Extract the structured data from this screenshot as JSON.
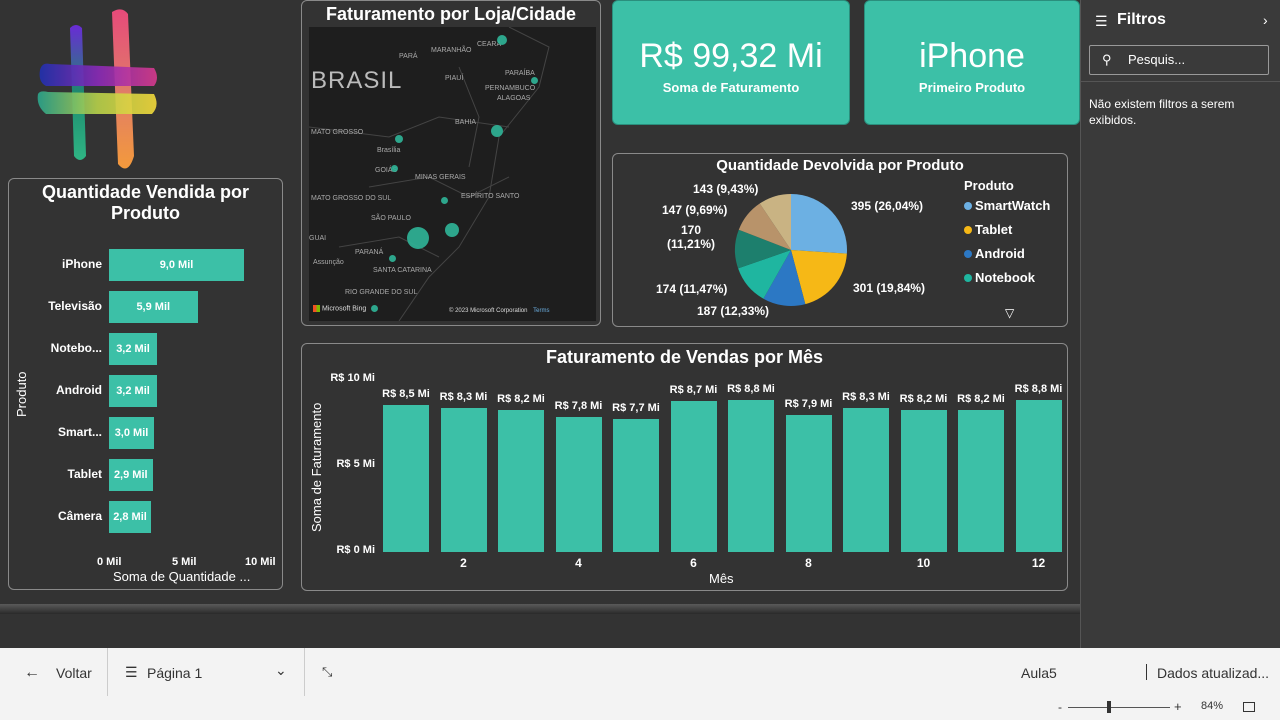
{
  "map": {
    "title": "Faturamento por Loja/Cidade",
    "labels": [
      "BRASIL",
      "PARÁ",
      "MARANHÃO",
      "CEARÁ",
      "PARAÍBA",
      "PIAUÍ",
      "PERNAMBUCO",
      "ALAGOAS",
      "BAHIA",
      "MATO GROSSO",
      "Brasília",
      "GOIÁS",
      "MINAS GERAIS",
      "ESPÍRITO SANTO",
      "MATO GROSSO DO SUL",
      "SÃO PAULO",
      "PARANÁ",
      "SANTA CATARINA",
      "RIO GRANDE DO SUL",
      "Assunção",
      "GUAI"
    ],
    "brand": "Microsoft Bing",
    "copyright": "© 2023 Microsoft Corporation",
    "terms": "Terms"
  },
  "kpi": {
    "total_value": "R$ 99,32 Mi",
    "total_label": "Soma de Faturamento",
    "top_value": "iPhone",
    "top_label": "Primeiro Produto"
  },
  "qty_chart": {
    "title": "Quantidade Vendida por Produto",
    "ylabel": "Produto",
    "xlabel": "Soma de Quantidade ...",
    "xticks": [
      "0 Mil",
      "5 Mil",
      "10 Mil"
    ]
  },
  "pie_chart": {
    "title": "Quantidade Devolvida por Produto",
    "legend_title": "Produto"
  },
  "month_chart": {
    "title": "Faturamento de Vendas por Mês",
    "ylabel": "Soma de Faturamento",
    "xlabel": "Mês",
    "yticks": [
      "R$ 10 Mi",
      "R$ 5 Mi",
      "R$ 0 Mi"
    ],
    "xticks": [
      "2",
      "4",
      "6",
      "8",
      "10",
      "12"
    ]
  },
  "chart_data": [
    {
      "type": "bar",
      "orientation": "horizontal",
      "title": "Quantidade Vendida por Produto",
      "categories": [
        "iPhone",
        "Televisão",
        "Notebo...",
        "Android",
        "Smart...",
        "Tablet",
        "Câmera"
      ],
      "values": [
        9.0,
        5.9,
        3.2,
        3.2,
        3.0,
        2.9,
        2.8
      ],
      "data_labels": [
        "9,0 Mil",
        "5,9 Mil",
        "3,2 Mil",
        "3,2 Mil",
        "3,0 Mil",
        "2,9 Mil",
        "2,8 Mil"
      ],
      "xlabel": "Soma de Quantidade ...",
      "ylabel": "Produto",
      "xlim": [
        0,
        10
      ]
    },
    {
      "type": "pie",
      "title": "Quantidade Devolvida por Produto",
      "slices": [
        {
          "name": "SmartWatch",
          "value": 395,
          "label": "395 (26,04%)",
          "color": "#6cb0e3"
        },
        {
          "name": "Tablet",
          "value": 301,
          "label": "301 (19,84%)",
          "color": "#f6b816"
        },
        {
          "name": "Android",
          "value": 187,
          "label": "187 (12,33%)",
          "color": "#2c78c4"
        },
        {
          "name": "Notebook",
          "value": 174,
          "label": "174 (11,47%)",
          "color": "#1fb6a0"
        },
        {
          "name": "",
          "value": 170,
          "label": "170 (11,21%)",
          "color": "#1d7f6d"
        },
        {
          "name": "",
          "value": 147,
          "label": "147 (9,69%)",
          "color": "#b8936a"
        },
        {
          "name": "",
          "value": 143,
          "label": "143 (9,43%)",
          "color": "#c9b383"
        }
      ],
      "legend": [
        "SmartWatch",
        "Tablet",
        "Android",
        "Notebook"
      ]
    },
    {
      "type": "bar",
      "title": "Faturamento de Vendas por Mês",
      "categories": [
        1,
        2,
        3,
        4,
        5,
        6,
        7,
        8,
        9,
        10,
        11,
        12
      ],
      "values": [
        8.5,
        8.3,
        8.2,
        7.8,
        7.7,
        8.7,
        8.8,
        7.9,
        8.3,
        8.2,
        8.2,
        8.8
      ],
      "data_labels": [
        "R$ 8,5 Mi",
        "R$ 8,3 Mi",
        "R$ 8,2 Mi",
        "R$ 7,8 Mi",
        "R$ 7,7 Mi",
        "R$ 8,7 Mi",
        "R$ 8,8 Mi",
        "R$ 7,9 Mi",
        "R$ 8,3 Mi",
        "R$ 8,2 Mi",
        "R$ 8,2 Mi",
        "R$ 8,8 Mi"
      ],
      "xlabel": "Mês",
      "ylabel": "Soma de Faturamento",
      "ylim": [
        0,
        10
      ]
    }
  ],
  "filters": {
    "title": "Filtros",
    "search_placeholder": "Pesquis...",
    "empty_note": "Não existem filtros a serem exibidos."
  },
  "bottom": {
    "back": "Voltar",
    "page": "Página 1",
    "report": "Aula5",
    "updated": "Dados atualizad...",
    "zoom": "84%",
    "zoom_minus": "-",
    "zoom_plus": "+"
  },
  "colors": {
    "accent": "#3cc0a7",
    "background": "#333333"
  }
}
